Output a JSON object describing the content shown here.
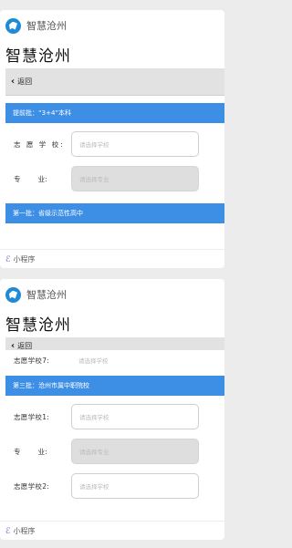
{
  "app_name": "智慧沧州",
  "page_title": "智慧沧州",
  "back_label": "返回",
  "footer_label": "小程序",
  "placeholders": {
    "school": "请选择学校",
    "major": "请选择专业"
  },
  "card1": {
    "section1_title": "提前批：“3+4”本科",
    "fields": [
      {
        "label": "志 愿 学 校:",
        "placeholder_key": "school"
      },
      {
        "label": "专       业:",
        "placeholder_key": "major"
      }
    ],
    "section2_title": "第一批：省级示范性高中"
  },
  "card2": {
    "top_field_label": "志愿学校7:",
    "section_title": "第三批：沧州市属中职院校",
    "fields": [
      {
        "label": "志愿学校1:"
      },
      {
        "label": "专       业:"
      },
      {
        "label": "志愿学校2:"
      }
    ]
  },
  "colors": {
    "section_blue": "#3d8fe6",
    "logo_blue": "#1e8bd6"
  }
}
